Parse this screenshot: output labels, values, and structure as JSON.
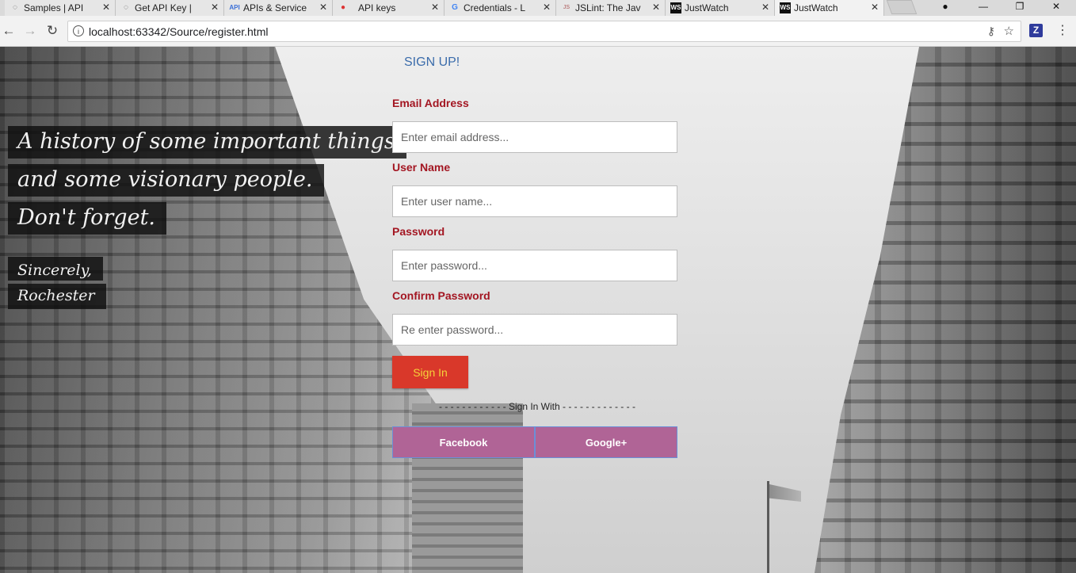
{
  "browser": {
    "tabs": [
      {
        "title": "Samples | API",
        "icon": "chrome-page-icon",
        "active": false
      },
      {
        "title": "Get API Key |",
        "icon": "chrome-page-icon",
        "active": false
      },
      {
        "title": "APIs & Service",
        "icon": "api-icon",
        "active": false
      },
      {
        "title": "API keys",
        "icon": "api-console-icon",
        "active": false
      },
      {
        "title": "Credentials - L",
        "icon": "google-icon",
        "active": false
      },
      {
        "title": "JSLint: The Jav",
        "icon": "jslint-icon",
        "active": false
      },
      {
        "title": "JustWatch",
        "icon": "webstorm-icon",
        "active": false
      },
      {
        "title": "JustWatch",
        "icon": "webstorm-icon",
        "active": true
      }
    ],
    "url": "localhost:63342/Source/register.html",
    "extension_letter": "Z"
  },
  "quote": {
    "line1": "A history of some important things",
    "line2": "and some visionary people.",
    "line3": "Don't forget.",
    "signoff1": "Sincerely,",
    "signoff2": "Rochester"
  },
  "form": {
    "title": "SIGN UP!",
    "email_label": "Email Address",
    "email_placeholder": "Enter email address...",
    "username_label": "User Name",
    "username_placeholder": "Enter user name...",
    "password_label": "Password",
    "password_placeholder": "Enter password...",
    "confirm_label": "Confirm Password",
    "confirm_placeholder": "Re enter password...",
    "signin_label": "Sign In",
    "divider_text": "- - - - - - - - - - - - Sign In With - - - - - - - - - - - - -",
    "facebook_label": "Facebook",
    "google_label": "Google+"
  },
  "colors": {
    "label": "#a31622",
    "title": "#3b6cab",
    "signin_bg": "#d9382a",
    "signin_text": "#f5d33a",
    "social_bg": "#b06496"
  }
}
